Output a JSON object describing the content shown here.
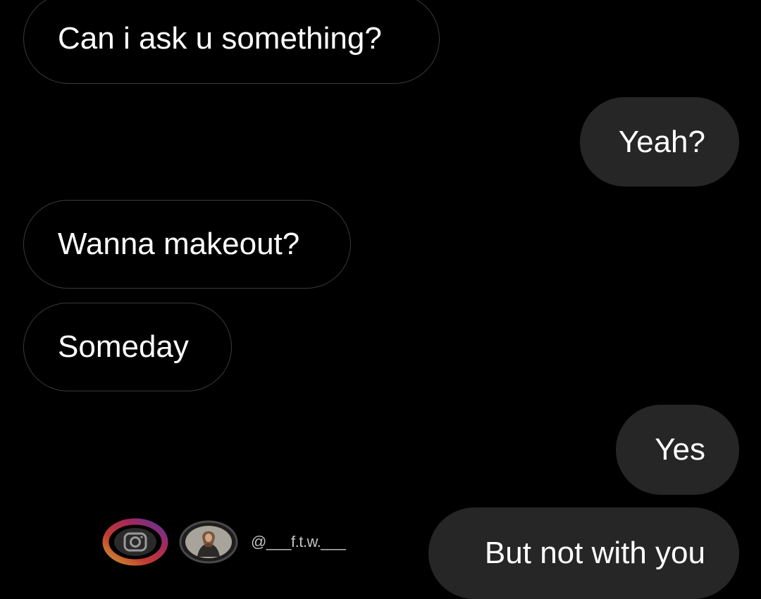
{
  "conversation": {
    "messages": [
      {
        "direction": "received",
        "text": "Can i ask u something?"
      },
      {
        "direction": "sent",
        "text": "Yeah?"
      },
      {
        "direction": "received",
        "text": "Wanna makeout?"
      },
      {
        "direction": "received",
        "text": "Someday"
      },
      {
        "direction": "sent",
        "text": "Yes"
      },
      {
        "direction": "sent",
        "text": "But not with you"
      }
    ]
  },
  "watermark": {
    "handle": "@___f.t.w.___",
    "icons": [
      "instagram-logo-icon",
      "profile-avatar"
    ]
  },
  "colors": {
    "background": "#000000",
    "sent_bubble": "#262626",
    "received_border": "#3a3a3a",
    "text": "#ffffff"
  }
}
